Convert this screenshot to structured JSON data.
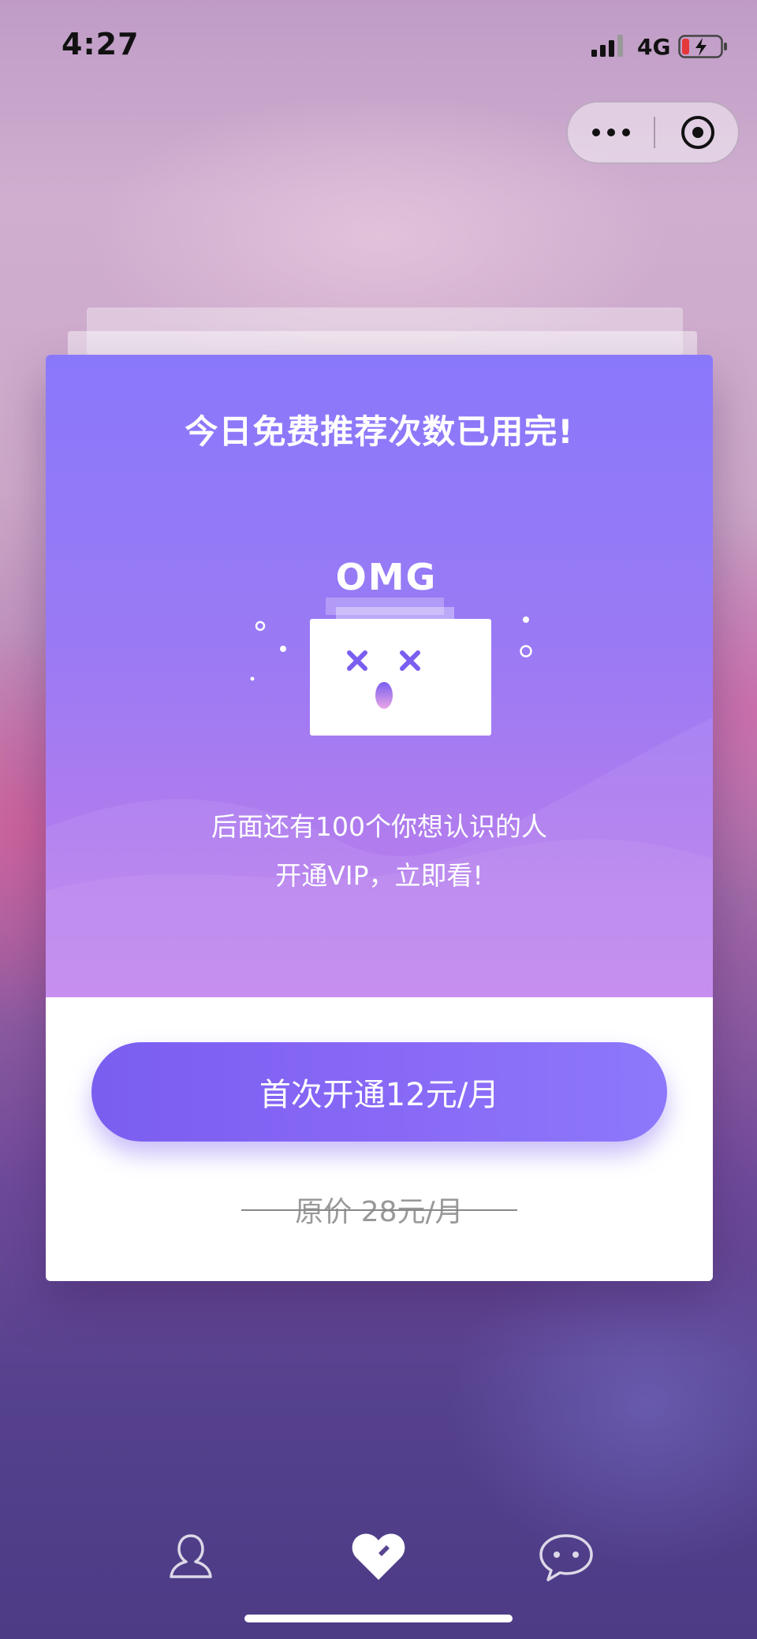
{
  "status_bar": {
    "time": "4:27",
    "network": "4G"
  },
  "capsule": {
    "more_icon": "more-dots-icon",
    "close_icon": "target-close-icon"
  },
  "card": {
    "title": "今日免费推荐次数已用完!",
    "illustration_text": "OMG",
    "description_line1": "后面还有100个你想认识的人",
    "description_line2": "开通VIP，立即看!",
    "cta_label": "首次开通12元/月",
    "original_price": "原价  28元/月"
  },
  "tab_bar": {
    "items": [
      {
        "icon": "profile-icon"
      },
      {
        "icon": "heart-icon"
      },
      {
        "icon": "chat-bubble-icon"
      }
    ]
  },
  "colors": {
    "card_gradient_top": "#8a78fb",
    "card_gradient_bottom": "#c080ee",
    "cta_start": "#7a5ef0",
    "cta_end": "#8d78fb",
    "battery_low": "#e5383b"
  }
}
